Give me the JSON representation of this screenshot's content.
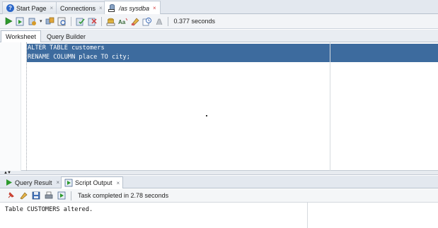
{
  "top_tabs": [
    {
      "label": "Start Page"
    },
    {
      "label": "Connections"
    },
    {
      "label": "/as sysdba"
    }
  ],
  "toolbar": {
    "elapsed": "0.377 seconds"
  },
  "worksheet_tabs": [
    {
      "label": "Worksheet"
    },
    {
      "label": "Query Builder"
    }
  ],
  "editor": {
    "lines": [
      "ALTER TABLE customers",
      "RENAME COLUMN place TO city;"
    ]
  },
  "bottom_tabs": [
    {
      "label": "Query Result"
    },
    {
      "label": "Script Output"
    }
  ],
  "output_toolbar": {
    "status": "Task completed in 2.78 seconds"
  },
  "output": {
    "text": "Table CUSTOMERS altered."
  },
  "icons": {
    "help": "help-icon",
    "run": "run-statement-icon",
    "run_script": "run-script-icon",
    "commit": "commit-icon",
    "rollback": "rollback-icon"
  },
  "colors": {
    "selection": "#3d6b9e",
    "run_green": "#2d9a2d",
    "close_red": "#d23c3c"
  }
}
